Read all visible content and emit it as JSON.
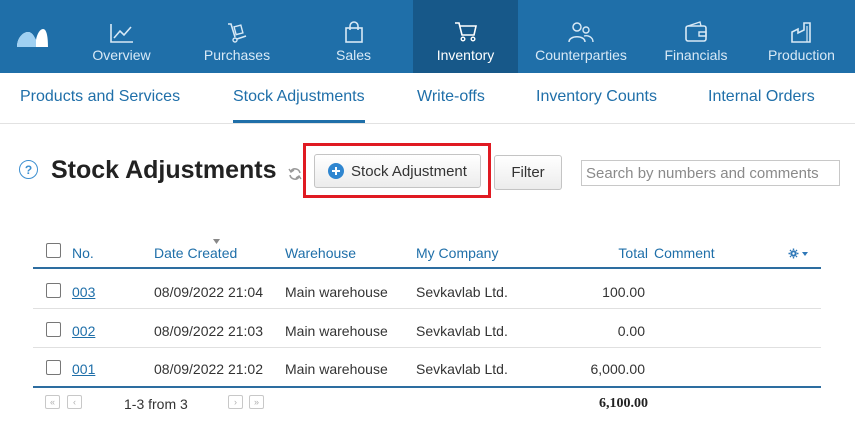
{
  "top_nav": {
    "items": [
      {
        "label": "Overview",
        "icon": "chart-line-icon"
      },
      {
        "label": "Purchases",
        "icon": "hand-truck-icon"
      },
      {
        "label": "Sales",
        "icon": "shopping-bag-icon"
      },
      {
        "label": "Inventory",
        "icon": "shopping-cart-icon",
        "active": true
      },
      {
        "label": "Counterparties",
        "icon": "users-icon"
      },
      {
        "label": "Financials",
        "icon": "wallet-icon"
      },
      {
        "label": "Production",
        "icon": "factory-icon"
      }
    ]
  },
  "sub_nav": {
    "items": [
      {
        "label": "Products and Services"
      },
      {
        "label": "Stock Adjustments",
        "active": true
      },
      {
        "label": "Write-offs"
      },
      {
        "label": "Inventory Counts"
      },
      {
        "label": "Internal Orders"
      }
    ]
  },
  "page": {
    "help": "?",
    "title": "Stock Adjustments",
    "add_button": "Stock Adjustment",
    "filter_button": "Filter",
    "search_placeholder": "Search by numbers and comments"
  },
  "table": {
    "columns": {
      "no": "No.",
      "date_created": "Date Created",
      "warehouse": "Warehouse",
      "my_company": "My Company",
      "total": "Total",
      "comment": "Comment"
    },
    "rows": [
      {
        "no": "003",
        "date": "08/09/2022 21:04",
        "warehouse": "Main warehouse",
        "company": "Sevkavlab Ltd.",
        "total": "100.00",
        "comment": ""
      },
      {
        "no": "002",
        "date": "08/09/2022 21:03",
        "warehouse": "Main warehouse",
        "company": "Sevkavlab Ltd.",
        "total": "0.00",
        "comment": ""
      },
      {
        "no": "001",
        "date": "08/09/2022 21:02",
        "warehouse": "Main warehouse",
        "company": "Sevkavlab Ltd.",
        "total": "6,000.00",
        "comment": ""
      }
    ],
    "range_text": "1-3 from 3",
    "grand_total": "6,100.00"
  },
  "colors": {
    "nav_bg": "#1f6fa9",
    "nav_active_bg": "#175889",
    "link": "#1f6fa9",
    "highlight": "#e01a22"
  }
}
